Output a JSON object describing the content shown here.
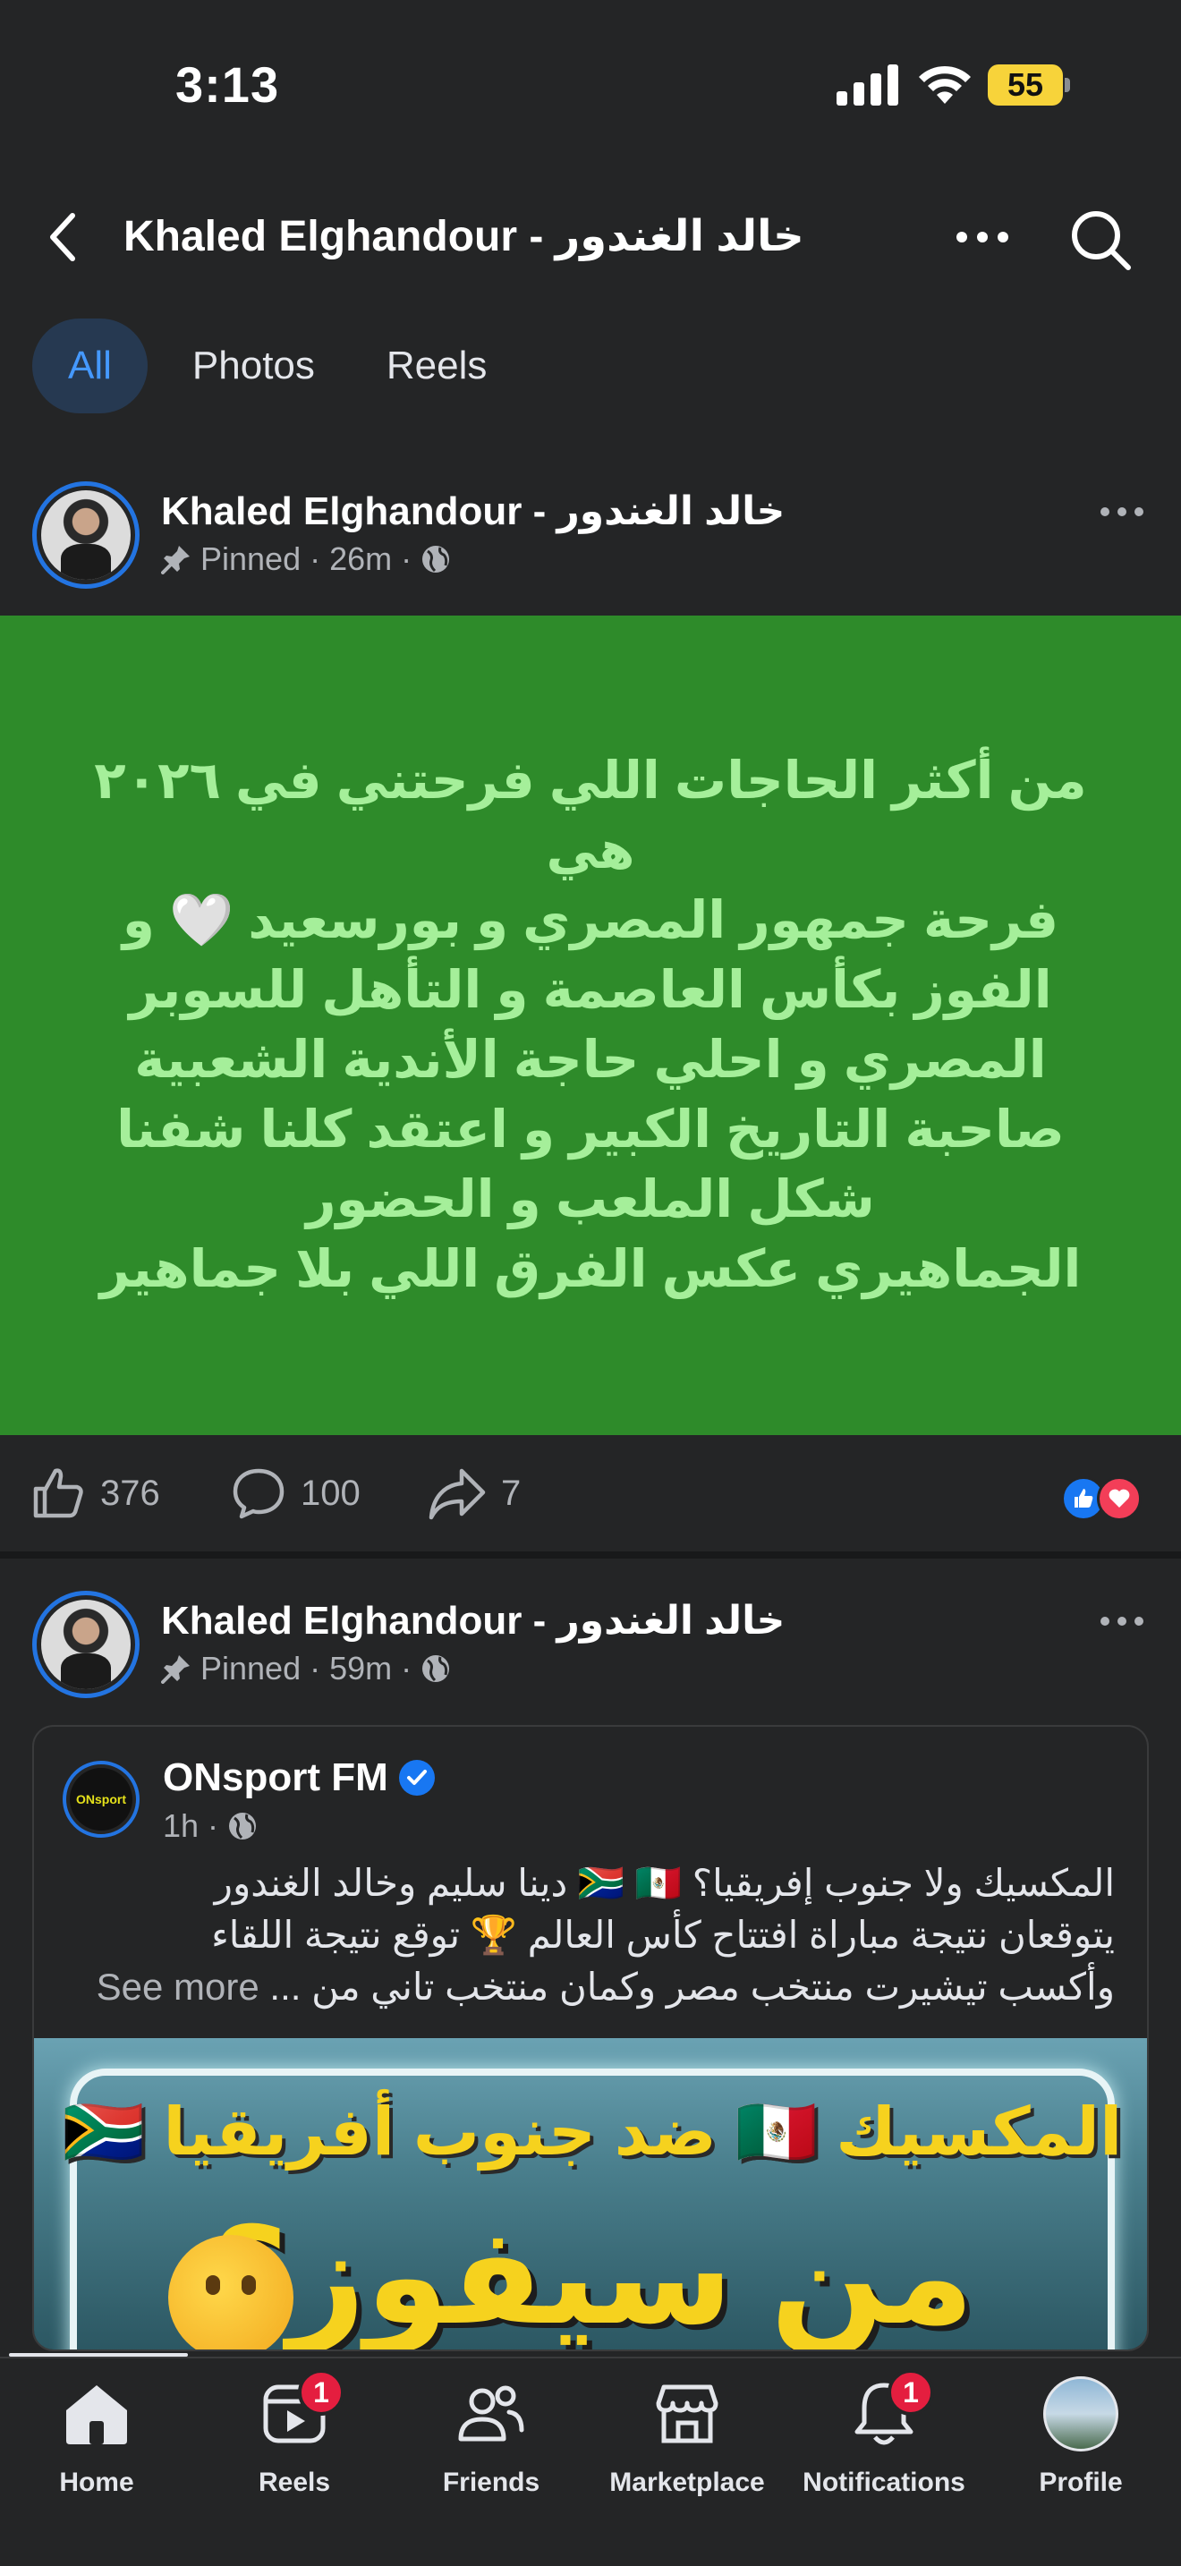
{
  "status_bar": {
    "time": "3:13",
    "battery": "55"
  },
  "header": {
    "title": "Khaled Elghandour - خالد الغندور"
  },
  "tabs": [
    {
      "label": "All"
    },
    {
      "label": "Photos"
    },
    {
      "label": "Reels"
    }
  ],
  "post1": {
    "author": "Khaled Elghandour - خالد الغندور",
    "pinned": "Pinned",
    "time": "26m",
    "text": "من أكثر الحاجات اللي فرحتني في ٢٠٢٦ هي\nفرحة جمهور المصري و بورسعيد  🤍 و\nالفوز بكأس العاصمة و التأهل للسوبر\nالمصري  و احلي حاجة الأندية الشعبية\nصاحبة التاريخ الكبير  و اعتقد كلنا شفنا\nشكل الملعب و الحضور\nالجماهيري عكس الفرق اللي بلا جماهير",
    "likes": "376",
    "comments": "100",
    "shares": "7"
  },
  "post2": {
    "author": "Khaled Elghandour - خالد الغندور",
    "pinned": "Pinned",
    "time": "59m",
    "shared": {
      "page_name": "ONsport FM",
      "time": "1h",
      "logo_text": "ONsport",
      "lines": [
        "المكسيك ولا جنوب إفريقيا؟ 🇿🇦 🇲🇽 دينا سليم وخالد الغندور",
        "يتوقعان نتيجة مباراة افتتاح كأس العالم 🏆 توقع نتيجة اللقاء",
        "وأكسب تيشيرت منتخب مصر وكمان منتخب تاني من ..."
      ],
      "see_more": "See more",
      "image_headline": "المكسيك 🇲🇽 ضد جنوب أفريقيا 🇿🇦",
      "image_question": "من سيفوز؟"
    }
  },
  "bottom_nav": [
    {
      "label": "Home",
      "icon": "home-icon",
      "active": true
    },
    {
      "label": "Reels",
      "icon": "reels-icon",
      "badge": "1"
    },
    {
      "label": "Friends",
      "icon": "friends-icon"
    },
    {
      "label": "Marketplace",
      "icon": "marketplace-icon"
    },
    {
      "label": "Notifications",
      "icon": "bell-icon",
      "badge": "1"
    },
    {
      "label": "Profile",
      "icon": "profile-icon"
    }
  ],
  "colors": {
    "background": "#242526",
    "accent": "#2374e1",
    "post_green": "#2e8b2a",
    "post_text": "#a5ef9a",
    "badge": "#e41e3f"
  }
}
